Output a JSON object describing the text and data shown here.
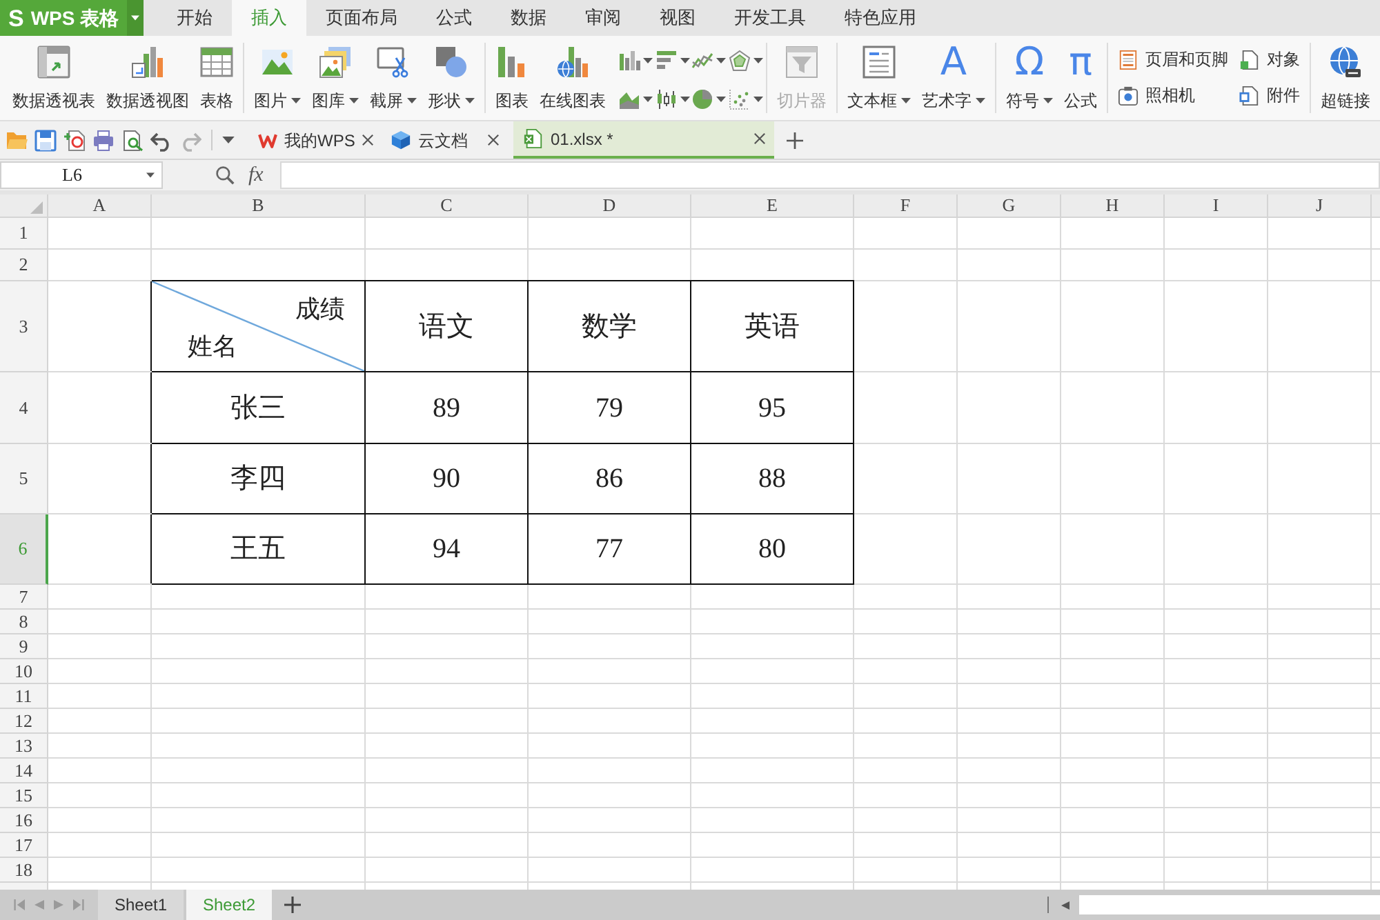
{
  "app": {
    "mark": "S",
    "name": "WPS 表格"
  },
  "menu_tabs": [
    {
      "label": "开始",
      "selected": false
    },
    {
      "label": "插入",
      "selected": true
    },
    {
      "label": "页面布局",
      "selected": false
    },
    {
      "label": "公式",
      "selected": false
    },
    {
      "label": "数据",
      "selected": false
    },
    {
      "label": "审阅",
      "selected": false
    },
    {
      "label": "视图",
      "selected": false
    },
    {
      "label": "开发工具",
      "selected": false
    },
    {
      "label": "特色应用",
      "selected": false
    }
  ],
  "ribbon": {
    "groups": [
      {
        "items": [
          {
            "kind": "large",
            "label": "数据透视表",
            "dropdown": false,
            "disabled": false
          },
          {
            "kind": "large",
            "label": "数据透视图",
            "dropdown": false,
            "disabled": false
          },
          {
            "kind": "large",
            "label": "表格",
            "dropdown": false,
            "disabled": false
          }
        ]
      },
      {
        "items": [
          {
            "kind": "large",
            "label": "图片",
            "dropdown": true,
            "disabled": false
          },
          {
            "kind": "large",
            "label": "图库",
            "dropdown": true,
            "disabled": false
          },
          {
            "kind": "large",
            "label": "截屏",
            "dropdown": true,
            "disabled": false
          },
          {
            "kind": "large",
            "label": "形状",
            "dropdown": true,
            "disabled": false
          }
        ]
      },
      {
        "items": [
          {
            "kind": "large",
            "label": "图表",
            "dropdown": false,
            "disabled": false
          },
          {
            "kind": "large",
            "label": "在线图表",
            "dropdown": false,
            "disabled": false
          },
          {
            "kind": "small",
            "dropdown": true,
            "disabled": false
          },
          {
            "kind": "small",
            "dropdown": true,
            "disabled": false
          },
          {
            "kind": "small",
            "dropdown": true,
            "disabled": false
          },
          {
            "kind": "small",
            "dropdown": true,
            "disabled": false
          },
          {
            "kind": "small",
            "dropdown": true,
            "disabled": false
          },
          {
            "kind": "small",
            "dropdown": true,
            "disabled": false
          },
          {
            "kind": "small",
            "dropdown": true,
            "disabled": false
          },
          {
            "kind": "small",
            "dropdown": true,
            "disabled": false
          }
        ]
      },
      {
        "items": [
          {
            "kind": "large",
            "label": "切片器",
            "dropdown": false,
            "disabled": true
          }
        ]
      },
      {
        "items": [
          {
            "kind": "large",
            "label": "文本框",
            "dropdown": true,
            "disabled": false
          },
          {
            "kind": "large",
            "label": "艺术字",
            "glyph": "A",
            "dropdown": true,
            "disabled": false
          }
        ]
      },
      {
        "items": [
          {
            "kind": "large",
            "label": "符号",
            "glyph": "Ω",
            "dropdown": true,
            "disabled": false
          },
          {
            "kind": "large",
            "label": "公式",
            "glyph": "π",
            "dropdown": false,
            "disabled": false
          }
        ]
      },
      {
        "items": [
          {
            "kind": "row",
            "label": "页眉和页脚",
            "dropdown": false,
            "disabled": false
          },
          {
            "kind": "row",
            "label": "照相机",
            "dropdown": false,
            "disabled": false
          },
          {
            "kind": "row",
            "label": "对象",
            "dropdown": false,
            "disabled": false
          },
          {
            "kind": "row",
            "label": "附件",
            "dropdown": false,
            "disabled": false
          }
        ]
      },
      {
        "items": [
          {
            "kind": "large",
            "label": "超链接",
            "dropdown": false,
            "disabled": false
          }
        ]
      }
    ]
  },
  "quick_access": [
    {
      "disabled": false
    },
    {
      "disabled": false
    },
    {
      "disabled": false
    },
    {
      "disabled": false
    },
    {
      "disabled": false
    },
    {
      "disabled": false
    },
    {
      "disabled": true
    }
  ],
  "doc_tabs": [
    {
      "label": "我的WPS",
      "selected": false
    },
    {
      "label": "云文档",
      "selected": false
    },
    {
      "label": "01.xlsx *",
      "selected": true
    }
  ],
  "formula_bar": {
    "name_box": "L6",
    "function_label": "fx"
  },
  "sheet": {
    "columns": [
      "A",
      "B",
      "C",
      "D",
      "E",
      "F",
      "G",
      "H",
      "I",
      "J"
    ],
    "rows": [
      {
        "label": "1",
        "selected": false
      },
      {
        "label": "2",
        "selected": false
      },
      {
        "label": "3",
        "selected": false
      },
      {
        "label": "4",
        "selected": false
      },
      {
        "label": "5",
        "selected": false
      },
      {
        "label": "6",
        "selected": true
      },
      {
        "label": "7",
        "selected": false
      },
      {
        "label": "8",
        "selected": false
      },
      {
        "label": "9",
        "selected": false
      },
      {
        "label": "10",
        "selected": false
      },
      {
        "label": "11",
        "selected": false
      },
      {
        "label": "12",
        "selected": false
      },
      {
        "label": "13",
        "selected": false
      },
      {
        "label": "14",
        "selected": false
      },
      {
        "label": "15",
        "selected": false
      },
      {
        "label": "16",
        "selected": false
      },
      {
        "label": "17",
        "selected": false
      },
      {
        "label": "18",
        "selected": false
      }
    ]
  },
  "table": {
    "corner": {
      "top_right": "成绩",
      "bottom_left": "姓名"
    },
    "subjects": [
      "语文",
      "数学",
      "英语"
    ],
    "rows": [
      {
        "name": "张三",
        "scores": [
          "89",
          "79",
          "95"
        ]
      },
      {
        "name": "李四",
        "scores": [
          "90",
          "86",
          "88"
        ]
      },
      {
        "name": "王五",
        "scores": [
          "94",
          "77",
          "80"
        ]
      }
    ]
  },
  "sheet_tabs": [
    {
      "label": "Sheet1",
      "selected": false
    },
    {
      "label": "Sheet2",
      "selected": true
    }
  ]
}
